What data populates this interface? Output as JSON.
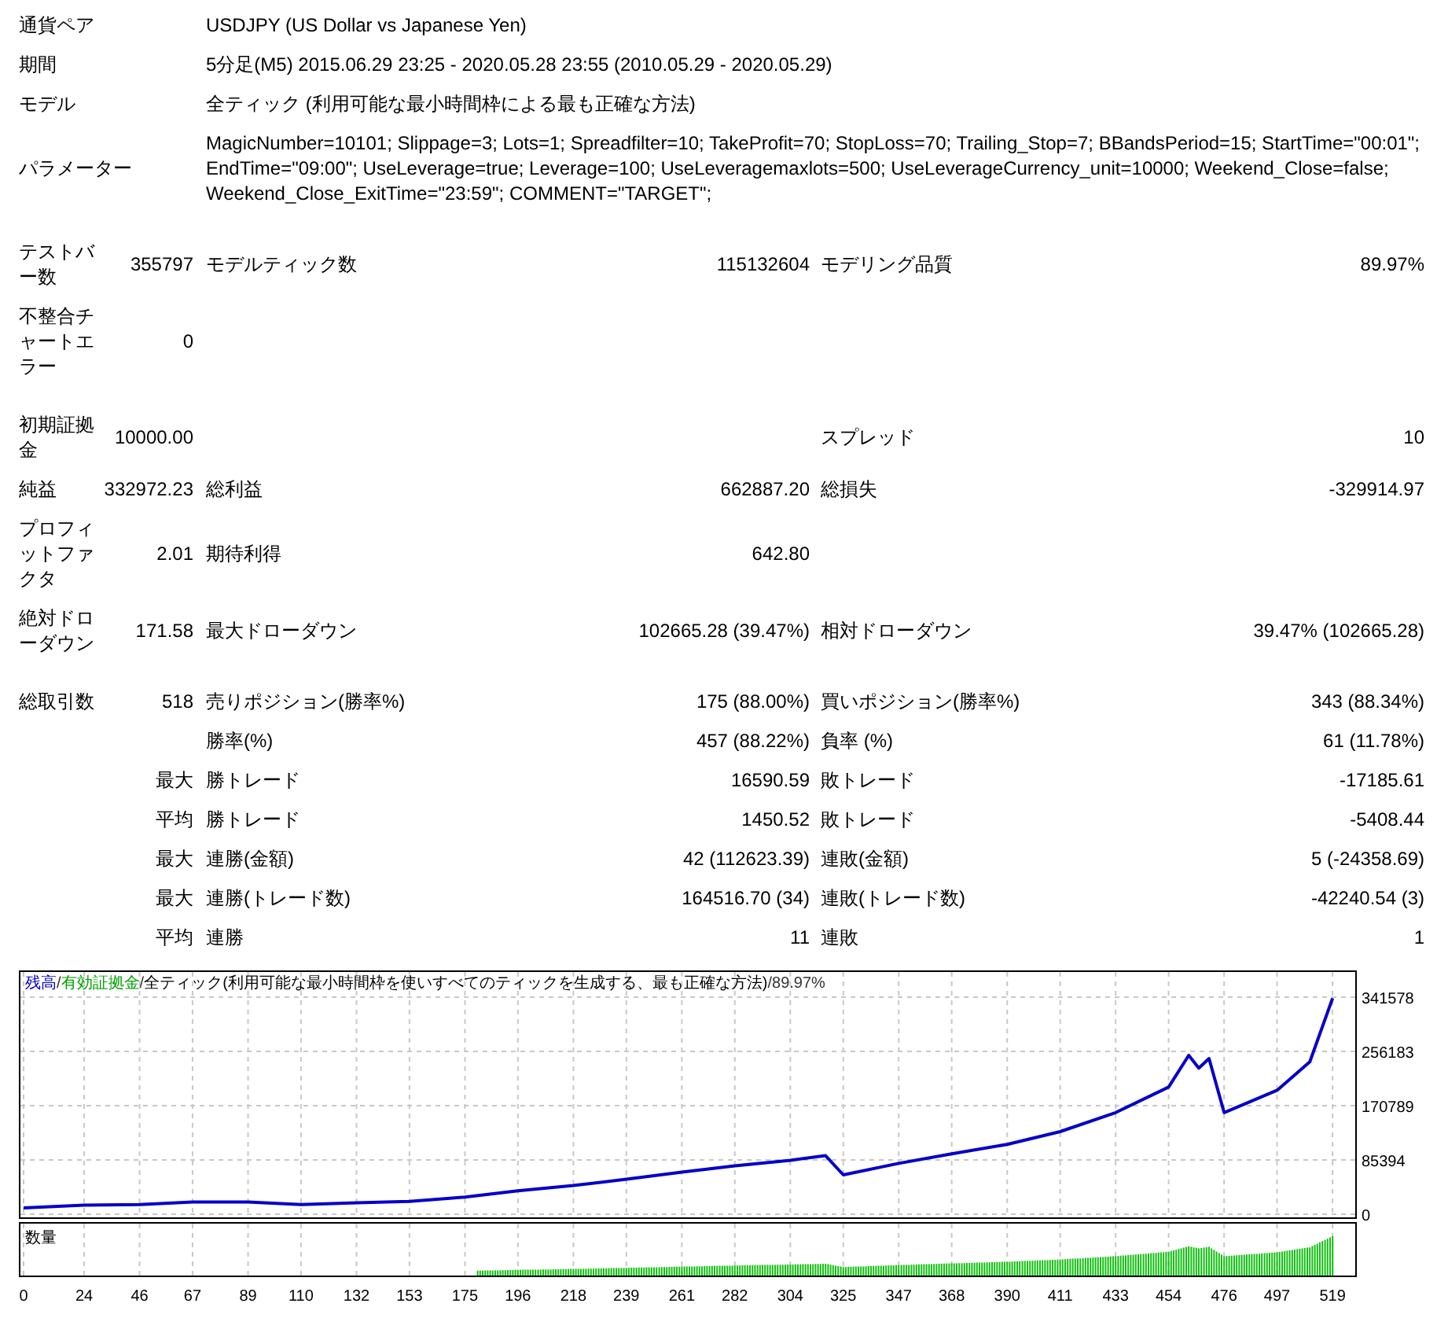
{
  "summary": [
    {
      "label": "通貨ペア",
      "value": "USDJPY (US Dollar vs Japanese Yen)"
    },
    {
      "label": "期間",
      "value": "5分足(M5) 2015.06.29 23:25 - 2020.05.28 23:55 (2010.05.29 - 2020.05.29)"
    },
    {
      "label": "モデル",
      "value": "全ティック (利用可能な最小時間枠による最も正確な方法)"
    },
    {
      "label": "パラメーター",
      "value": "MagicNumber=10101; Slippage=3; Lots=1; Spreadfilter=10; TakeProfit=70; StopLoss=70; Trailing_Stop=7; BBandsPeriod=15; StartTime=\"00:01\"; EndTime=\"09:00\"; UseLeverage=true; Leverage=100; UseLeveragemaxlots=500; UseLeverageCurrency_unit=10000; Weekend_Close=false; Weekend_Close_ExitTime=\"23:59\"; COMMENT=\"TARGET\";"
    }
  ],
  "stats": [
    [
      {
        "label": "テストバー数",
        "value": "355797",
        "mid": {
          "label": "モデルティック数",
          "value": "115132604"
        },
        "right": {
          "label": "モデリング品質",
          "value": "89.97%"
        }
      },
      {
        "label": "不整合チャートエラー",
        "value": "0"
      }
    ],
    [
      {
        "label": "初期証拠金",
        "value": "10000.00",
        "right": {
          "label": "スプレッド",
          "value": "10"
        }
      },
      {
        "label": "純益",
        "value": "332972.23",
        "mid": {
          "label": "総利益",
          "value": "662887.20"
        },
        "right": {
          "label": "総損失",
          "value": "-329914.97"
        }
      },
      {
        "label": "プロフィットファクタ",
        "value": "2.01",
        "mid": {
          "label": "期待利得",
          "value": "642.80"
        }
      },
      {
        "label": "絶対ドローダウン",
        "value": "171.58",
        "mid": {
          "label": "最大ドローダウン",
          "value": "102665.28 (39.47%)"
        },
        "right": {
          "label": "相対ドローダウン",
          "value": "39.47% (102665.28)"
        }
      }
    ],
    [
      {
        "label": "総取引数",
        "value": "518",
        "mid": {
          "label": "売りポジション(勝率%)",
          "value": "175 (88.00%)"
        },
        "right": {
          "label": "買いポジション(勝率%)",
          "value": "343 (88.34%)"
        }
      },
      {
        "mid": {
          "label": "勝率(%)",
          "value": "457 (88.22%)"
        },
        "right": {
          "label": "負率 (%)",
          "value": "61 (11.78%)"
        }
      },
      {
        "value": "最大",
        "mid": {
          "label": "勝トレード",
          "value": "16590.59"
        },
        "right": {
          "label": "敗トレード",
          "value": "-17185.61"
        }
      },
      {
        "value": "平均",
        "mid": {
          "label": "勝トレード",
          "value": "1450.52"
        },
        "right": {
          "label": "敗トレード",
          "value": "-5408.44"
        }
      },
      {
        "value": "最大",
        "mid": {
          "label": "連勝(金額)",
          "value": "42 (112623.39)"
        },
        "right": {
          "label": "連敗(金額)",
          "value": "5 (-24358.69)"
        }
      },
      {
        "value": "最大",
        "mid": {
          "label": "連勝(トレード数)",
          "value": "164516.70 (34)"
        },
        "right": {
          "label": "連敗(トレード数)",
          "value": "-42240.54 (3)"
        }
      },
      {
        "value": "平均",
        "mid": {
          "label": "連勝",
          "value": "11"
        },
        "right": {
          "label": "連敗",
          "value": "1"
        }
      }
    ]
  ],
  "chart": {
    "legend": [
      {
        "text": "/",
        "color": "#333333"
      },
      {
        "text": "有効証拠金",
        "color": "#00a000"
      },
      {
        "text": "/",
        "color": "#333333"
      },
      {
        "text": "全ティック(利用可能な最小時間枠を使いすべてのティックを生成する、最も正確な方法)",
        "color": "#000000"
      },
      {
        "text": "/",
        "color": "#333333"
      },
      {
        "text": "89.97%",
        "color": "#333333"
      }
    ],
    "volume_label": "数量",
    "chart_data": {
      "type": "line",
      "x": [
        0,
        24,
        46,
        67,
        89,
        110,
        132,
        153,
        175,
        196,
        218,
        239,
        261,
        282,
        304,
        318,
        325,
        347,
        368,
        390,
        411,
        433,
        454,
        462,
        466,
        470,
        476,
        497,
        510,
        519
      ],
      "series": [
        {
          "name": "残高",
          "color": "#0000c8",
          "values": [
            10000,
            14000,
            15000,
            19000,
            19000,
            15000,
            18000,
            20000,
            27000,
            37000,
            45000,
            55000,
            66000,
            76000,
            85000,
            92000,
            62000,
            80000,
            95000,
            110000,
            130000,
            160000,
            200000,
            250000,
            230000,
            245000,
            160000,
            195000,
            240000,
            340000
          ]
        }
      ],
      "xlim": [
        0,
        528
      ],
      "ylim": [
        0,
        380000
      ],
      "grid": true,
      "xticks": [
        0,
        24,
        46,
        67,
        89,
        110,
        132,
        153,
        175,
        196,
        218,
        239,
        261,
        282,
        304,
        325,
        347,
        368,
        390,
        411,
        433,
        454,
        476,
        497,
        519
      ],
      "yticks": [
        0,
        85394,
        170789,
        256183,
        341578
      ]
    }
  }
}
